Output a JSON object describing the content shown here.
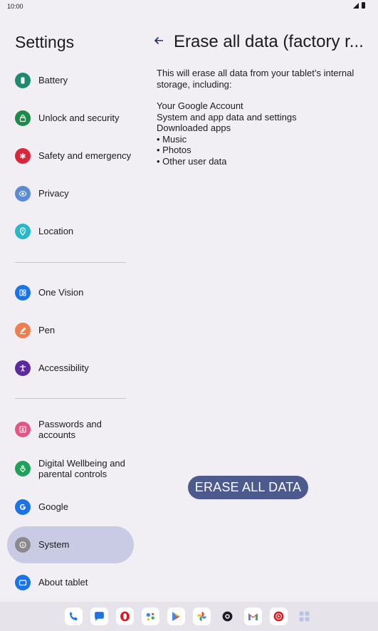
{
  "status": {
    "time": "10:00"
  },
  "settings_title": "Settings",
  "nav_items": [
    {
      "label": "Battery",
      "icon": "battery-icon",
      "color": "#1e8a6e"
    },
    {
      "label": "Unlock and security",
      "icon": "lock-icon",
      "color": "#1e8a47"
    },
    {
      "label": "Safety and emergency",
      "icon": "asterisk-icon",
      "color": "#d9263a"
    },
    {
      "label": "Privacy",
      "icon": "eye-icon",
      "color": "#5b8bd6"
    },
    {
      "label": "Location",
      "icon": "location-pin-icon",
      "color": "#27b8c9"
    },
    {
      "label": "One Vision",
      "icon": "grid-icon",
      "color": "#1a73e8"
    },
    {
      "label": "Pen",
      "icon": "pen-icon",
      "color": "#f27d4c"
    },
    {
      "label": "Accessibility",
      "icon": "accessibility-icon",
      "color": "#5b2a9d"
    },
    {
      "label": "Passwords and accounts",
      "icon": "account-box-icon",
      "color": "#e35584"
    },
    {
      "label": "Digital Wellbeing and parental controls",
      "icon": "wellbeing-icon",
      "color": "#1ea15a"
    },
    {
      "label": "Google",
      "icon": "google-icon",
      "color": "#1a73e8"
    },
    {
      "label": "System",
      "icon": "info-icon",
      "color": "#8a8a8e"
    },
    {
      "label": "About tablet",
      "icon": "tablet-icon",
      "color": "#1a73e8"
    }
  ],
  "detail": {
    "title": "Erase all data (factory r...",
    "description": "This will erase all data from your tablet’s internal storage, including:",
    "items": [
      "Your Google Account",
      "System and app data and settings",
      "Downloaded apps",
      "• Music",
      "• Photos",
      "• Other user data"
    ],
    "erase_button": "ERASE ALL DATA"
  },
  "dock_apps": [
    "phone-app-icon",
    "messages-app-icon",
    "opera-app-icon",
    "assistant-app-icon",
    "play-store-app-icon",
    "photos-app-icon",
    "camera-app-icon",
    "gmail-app-icon",
    "youtube-music-app-icon",
    "app-drawer-icon"
  ],
  "colors": {
    "accent": "#4d5a8e",
    "selected": "#c9cae4",
    "background": "#f1eff4"
  }
}
